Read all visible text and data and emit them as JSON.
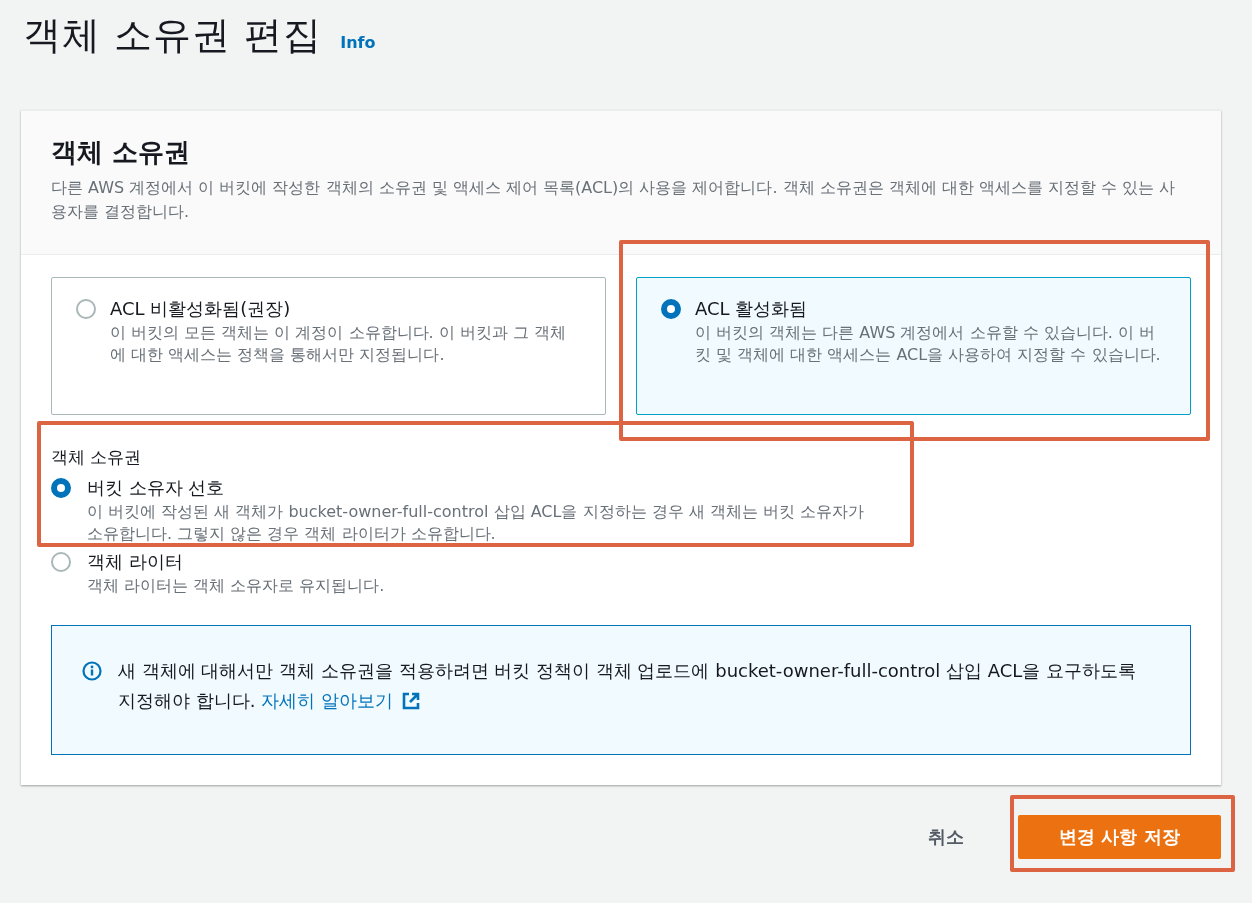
{
  "page": {
    "title": "객체 소유권 편집",
    "info_link": "Info"
  },
  "panel": {
    "heading": "객체 소유권",
    "description": "다른 AWS 계정에서 이 버킷에 작성한 객체의 소유권 및 액세스 제어 목록(ACL)의 사용을 제어합니다. 객체 소유권은 객체에 대한 액세스를 지정할 수 있는 사용자를 결정합니다."
  },
  "acl_options": [
    {
      "title": "ACL 비활성화됨(권장)",
      "description": "이 버킷의 모든 객체는 이 계정이 소유합니다. 이 버킷과 그 객체에 대한 액세스는 정책을 통해서만 지정됩니다.",
      "selected": false,
      "highlighted": false
    },
    {
      "title": "ACL 활성화됨",
      "description": "이 버킷의 객체는 다른 AWS 계정에서 소유할 수 있습니다. 이 버킷 및 객체에 대한 액세스는 ACL을 사용하여 지정할 수 있습니다.",
      "selected": true,
      "highlighted": true
    }
  ],
  "object_ownership": {
    "label": "객체 소유권",
    "highlighted": true,
    "options": [
      {
        "title": "버킷 소유자 선호",
        "description": "이 버킷에 작성된 새 객체가 bucket-owner-full-control 삽입 ACL을 지정하는 경우 새 객체는 버킷 소유자가 소유합니다. 그렇지 않은 경우 객체 라이터가 소유합니다.",
        "selected": true
      },
      {
        "title": "객체 라이터",
        "description": "객체 라이터는 객체 소유자로 유지됩니다.",
        "selected": false
      }
    ]
  },
  "info_alert": {
    "text": "새 객체에 대해서만 객체 소유권을 적용하려면 버킷 정책이 객체 업로드에 bucket-owner-full-control 삽입 ACL을 요구하도록 지정해야 합니다.",
    "link": "자세히 알아보기"
  },
  "actions": {
    "cancel": "취소",
    "save": "변경 사항 저장",
    "save_highlighted": true
  }
}
